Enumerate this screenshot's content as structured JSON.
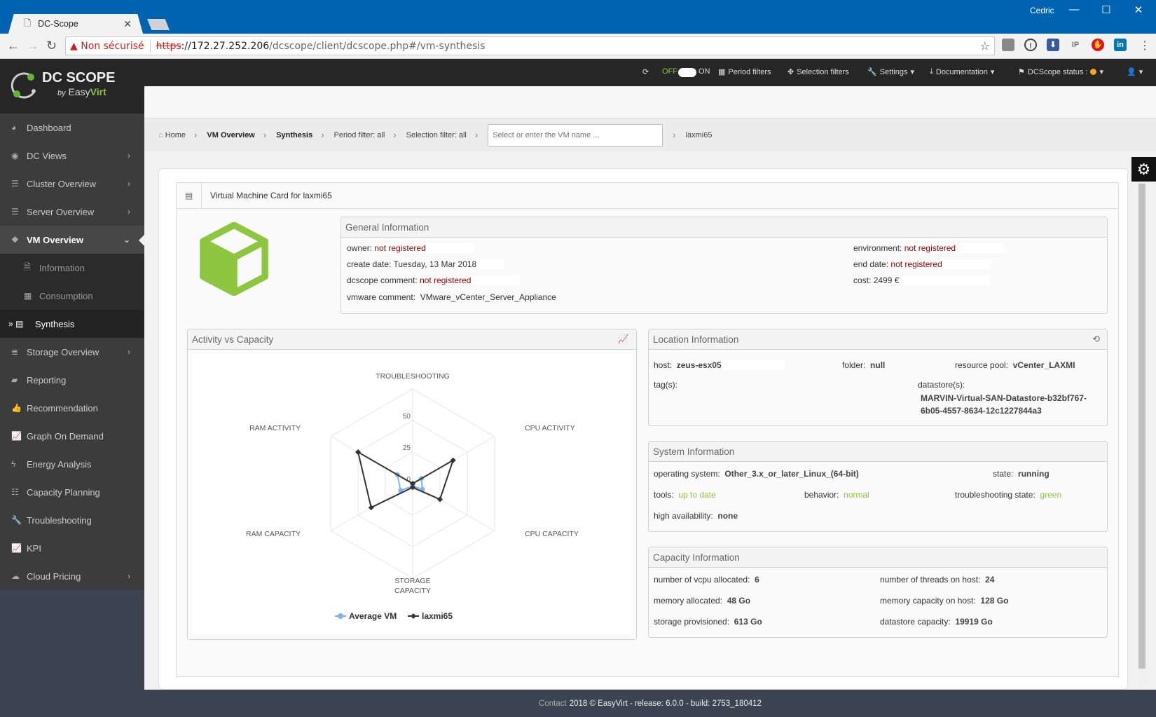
{
  "browser": {
    "tab_title": "DC-Scope",
    "user": "Cedric",
    "security": "Non sécurisé",
    "url_scheme": "https",
    "url_host": "://172.27.252.206",
    "url_path": "/dcscope/client/dcscope.php#/vm-synthesis"
  },
  "header": {
    "toggle_off": "OFF",
    "toggle_on": "ON",
    "period_filters": "Period filters",
    "selection_filters": "Selection filters",
    "settings": "Settings",
    "documentation": "Documentation",
    "status": "DCScope status :",
    "status_color": "#f5a623"
  },
  "logo": {
    "name": "DC SCOPE",
    "by": "by",
    "brand1": "Easy",
    "brand2": "Virt"
  },
  "sidebar": {
    "items": [
      {
        "label": "Dashboard",
        "icon": "dashboard-icon",
        "g": "◕"
      },
      {
        "label": "DC Views",
        "icon": "eye-icon",
        "g": "◉",
        "chev": "›"
      },
      {
        "label": "Cluster Overview",
        "icon": "cluster-icon",
        "g": "☰",
        "chev": "›"
      },
      {
        "label": "Server Overview",
        "icon": "server-icon",
        "g": "☰",
        "chev": "›"
      },
      {
        "label": "VM Overview",
        "icon": "cubes-icon",
        "g": "❖",
        "chev": "⌄",
        "active": true
      },
      {
        "label": "Information",
        "icon": "file-icon",
        "g": "🗎",
        "sub": true
      },
      {
        "label": "Consumption",
        "icon": "table-icon",
        "g": "▦",
        "sub": true
      },
      {
        "label": "Synthesis",
        "icon": "id-card-icon",
        "g": "» ▤",
        "cur": true
      },
      {
        "label": "Storage Overview",
        "icon": "database-icon",
        "g": "≣",
        "chev": "›"
      },
      {
        "label": "Reporting",
        "icon": "book-icon",
        "g": "▰"
      },
      {
        "label": "Recommendation",
        "icon": "thumbs-up-icon",
        "g": "👍"
      },
      {
        "label": "Graph On Demand",
        "icon": "line-chart-icon",
        "g": "📈"
      },
      {
        "label": "Energy Analysis",
        "icon": "bolt-icon",
        "g": "ϟ"
      },
      {
        "label": "Capacity Planning",
        "icon": "sliders-icon",
        "g": "☷"
      },
      {
        "label": "Troubleshooting",
        "icon": "wrench-icon",
        "g": "🔧"
      },
      {
        "label": "KPI",
        "icon": "line-chart-icon",
        "g": "📈"
      },
      {
        "label": "Cloud Pricing",
        "icon": "cloud-icon",
        "g": "☁",
        "chev": "›"
      }
    ]
  },
  "breadcrumb": {
    "home": "Home",
    "vm_overview": "VM Overview",
    "synthesis": "Synthesis",
    "period": "Period filter: all",
    "selection": "Selection filter: all",
    "search_placeholder": "Select or enter the VM name ...",
    "vm": "laxmi65"
  },
  "card": {
    "title": "Virtual Machine Card for laxmi65",
    "accent": "#8dc63f"
  },
  "general": {
    "title": "General Information",
    "owner_l": "owner:",
    "owner": "not registered",
    "create_l": "create date:",
    "create": "Tuesday, 13 Mar 2018",
    "comment_l": "dcscope comment:",
    "comment": "not registered",
    "vmware_l": "vmware comment:",
    "vmware": "VMware_vCenter_Server_Appliance",
    "env_l": "environment:",
    "env": "not registered",
    "end_l": "end date:",
    "end": "not registered",
    "cost_l": "cost:",
    "cost": "2499 €"
  },
  "location": {
    "title": "Location Information",
    "host_l": "host:",
    "host": "zeus-esx05",
    "folder_l": "folder:",
    "folder": "null",
    "pool_l": "resource pool:",
    "pool": "vCenter_LAXMI",
    "tags_l": "tag(s):",
    "ds_l": "datastore(s):",
    "ds1": "MARVIN-Virtual-SAN-Datastore-b32bf767-",
    "ds2": "6b05-4557-8634-12c1227844a3"
  },
  "system": {
    "title": "System Information",
    "os_l": "operating system:",
    "os": "Other_3.x_or_later_Linux_(64-bit)",
    "state_l": "state:",
    "state": "running",
    "tools_l": "tools:",
    "tools": "up to date",
    "behavior_l": "behavior:",
    "behavior": "normal",
    "ts_l": "troubleshooting state:",
    "ts": "green",
    "ha_l": "high availability:",
    "ha": "none"
  },
  "capacity": {
    "title": "Capacity Information",
    "vcpu_l": "number of vcpu allocated:",
    "vcpu": "6",
    "threads_l": "number of threads on host:",
    "threads": "24",
    "mem_l": "memory allocated:",
    "mem": "48 Go",
    "memcap_l": "memory capacity on host:",
    "memcap": "128 Go",
    "stor_l": "storage provisioned:",
    "stor": "613 Go",
    "dscap_l": "datastore capacity:",
    "dscap": "19919 Go"
  },
  "chart_data": {
    "type": "radar",
    "title": "Activity vs Capacity",
    "categories": [
      "TROUBLESHOOTING",
      "CPU ACTIVITY",
      "CPU CAPACITY",
      "STORAGE CAPACITY",
      "RAM CAPACITY",
      "RAM ACTIVITY"
    ],
    "ticks": [
      0,
      25,
      50
    ],
    "range": [
      0,
      75
    ],
    "grid": true,
    "legend": "bottom",
    "series": [
      {
        "name": "Average VM",
        "color": "#7cb5ec",
        "marker": "circle",
        "values": [
          0,
          8,
          9,
          2,
          11,
          14
        ]
      },
      {
        "name": "laxmi65",
        "color": "#333333",
        "marker": "diamond",
        "values": [
          0,
          37,
          25,
          3,
          38,
          50
        ]
      }
    ]
  },
  "footer": {
    "contact": "Contact",
    "text": "2018 © EasyVirt - release: 6.0.0 - build: 2753_180412"
  }
}
